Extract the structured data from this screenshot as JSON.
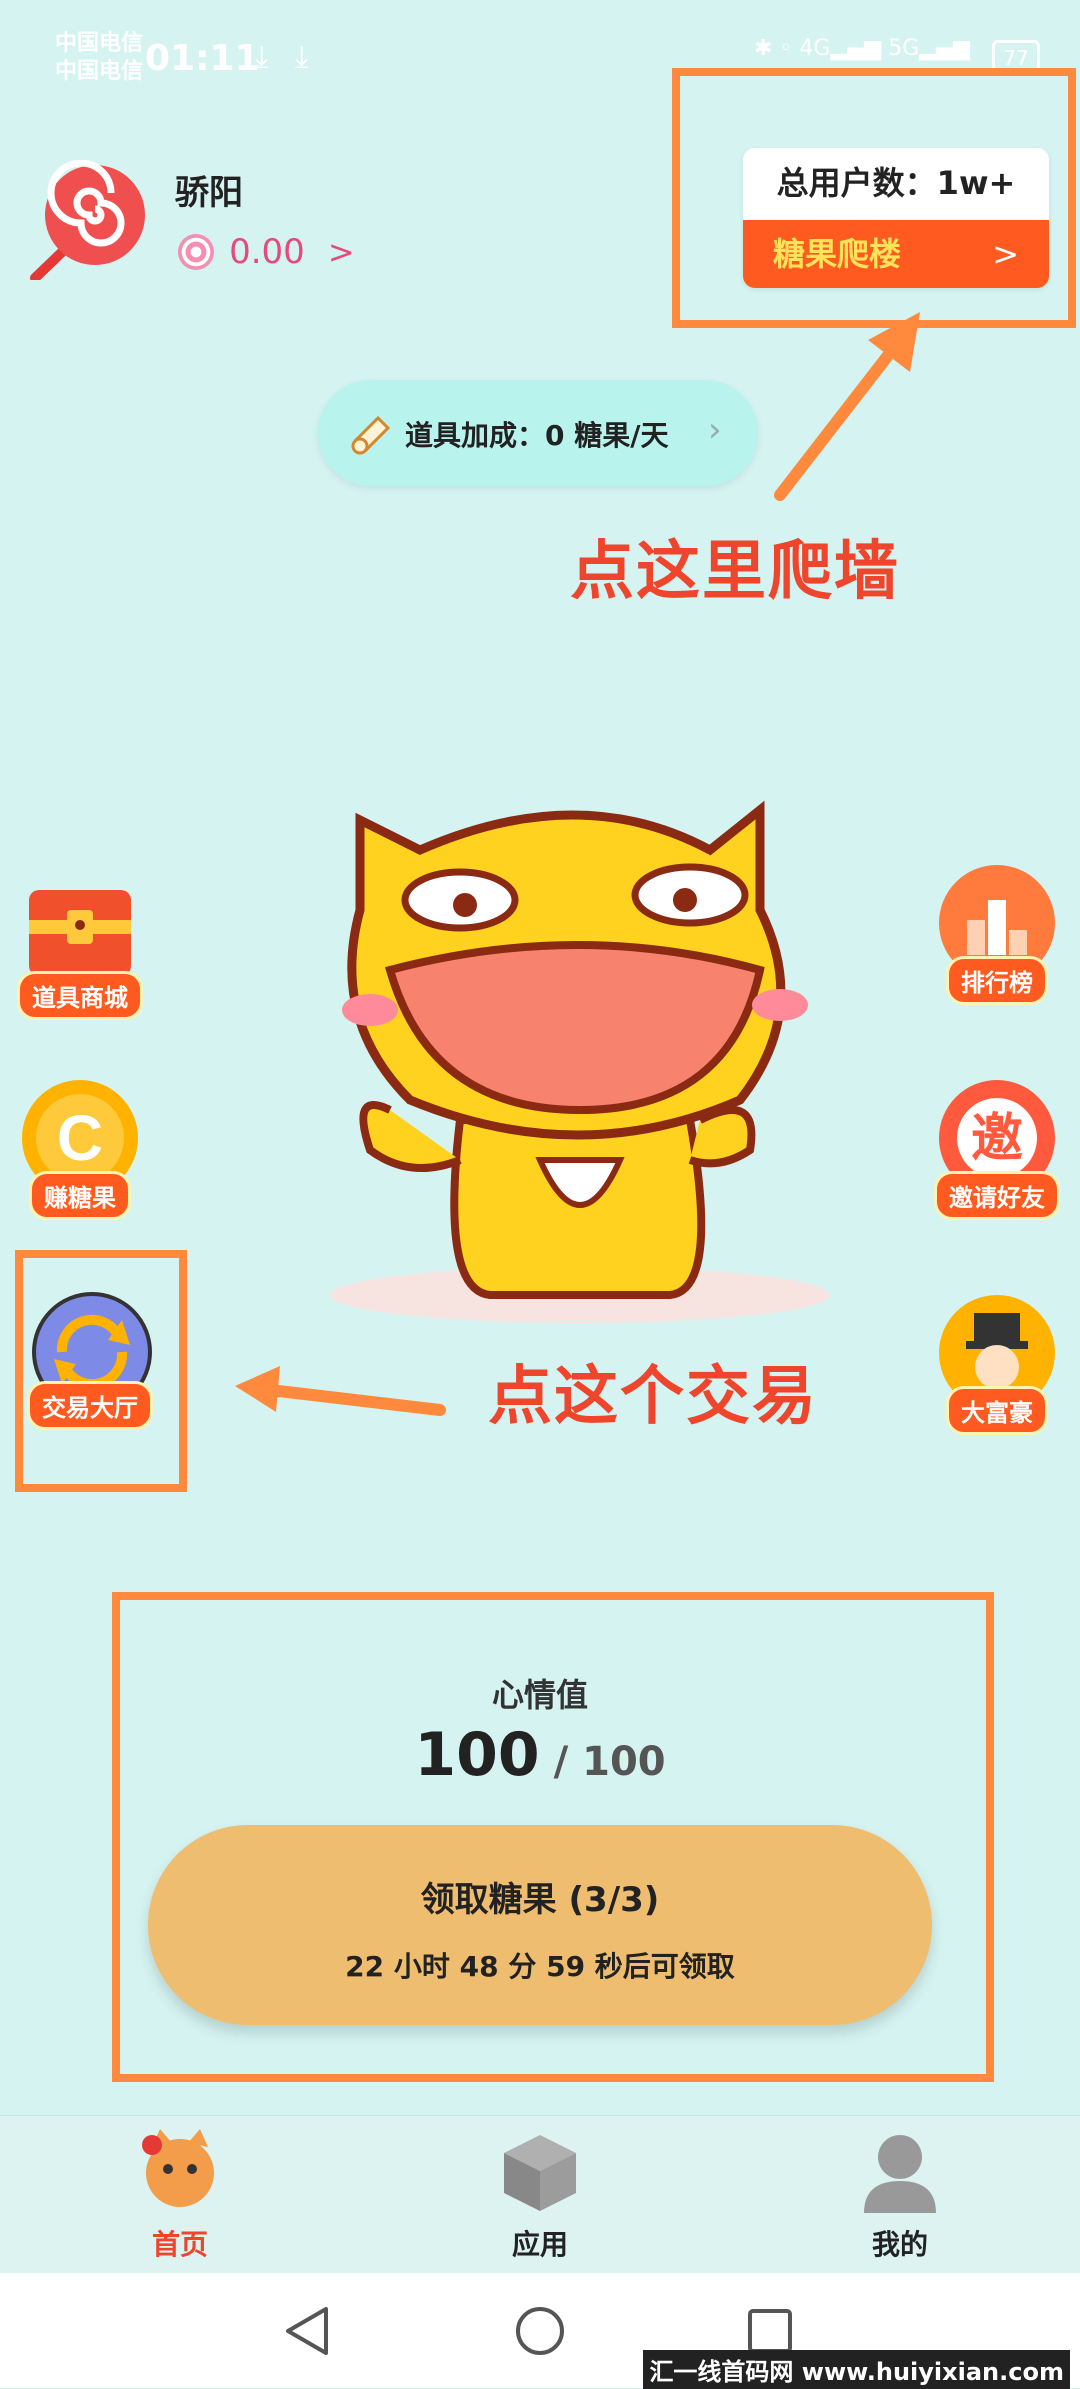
{
  "status_bar": {
    "carrier_1": "中国电信",
    "carrier_2": "中国电信",
    "time": "01:11",
    "battery": "77"
  },
  "profile": {
    "username": "骄阳",
    "balance": "0.00",
    "balance_chevron": ">"
  },
  "user_card": {
    "count_label": "总用户数：1w+",
    "climb_label": "糖果爬楼",
    "climb_chevron": ">"
  },
  "bonus": {
    "label": "道具加成：",
    "value": "0",
    "unit": " 糖果/天"
  },
  "annotations": {
    "climb_hint": "点这里爬墙",
    "trade_hint": "点这个交易"
  },
  "left_buttons": [
    {
      "label": "道具商城",
      "icon": "treasure-chest-icon"
    },
    {
      "label": "赚糖果",
      "icon": "coin-icon"
    },
    {
      "label": "交易大厅",
      "icon": "exchange-icon"
    }
  ],
  "right_buttons": [
    {
      "label": "排行榜",
      "icon": "ranking-icon"
    },
    {
      "label": "邀请好友",
      "icon": "invite-icon"
    },
    {
      "label": "大富豪",
      "icon": "tycoon-icon"
    }
  ],
  "mood": {
    "title": "心情值",
    "current": "100",
    "separator": " / ",
    "max": "100"
  },
  "claim": {
    "label": "领取糖果 (3/3)",
    "countdown": "22 小时 48 分 59 秒后可领取"
  },
  "bottom_nav": [
    {
      "label": "首页",
      "icon": "cat-mascot-icon",
      "active": true
    },
    {
      "label": "应用",
      "icon": "cube-icon",
      "active": false
    },
    {
      "label": "我的",
      "icon": "person-icon",
      "active": false
    }
  ],
  "watermark": "汇一线首码网 www.huiyixian.com",
  "colors": {
    "background": "#d5f4f1",
    "accent_orange": "#ff5a1f",
    "annotation_red": "#f0452d",
    "annotation_box": "#ff8a3d",
    "claim_button": "#efbd70",
    "balance_pink": "#e64a7a"
  }
}
